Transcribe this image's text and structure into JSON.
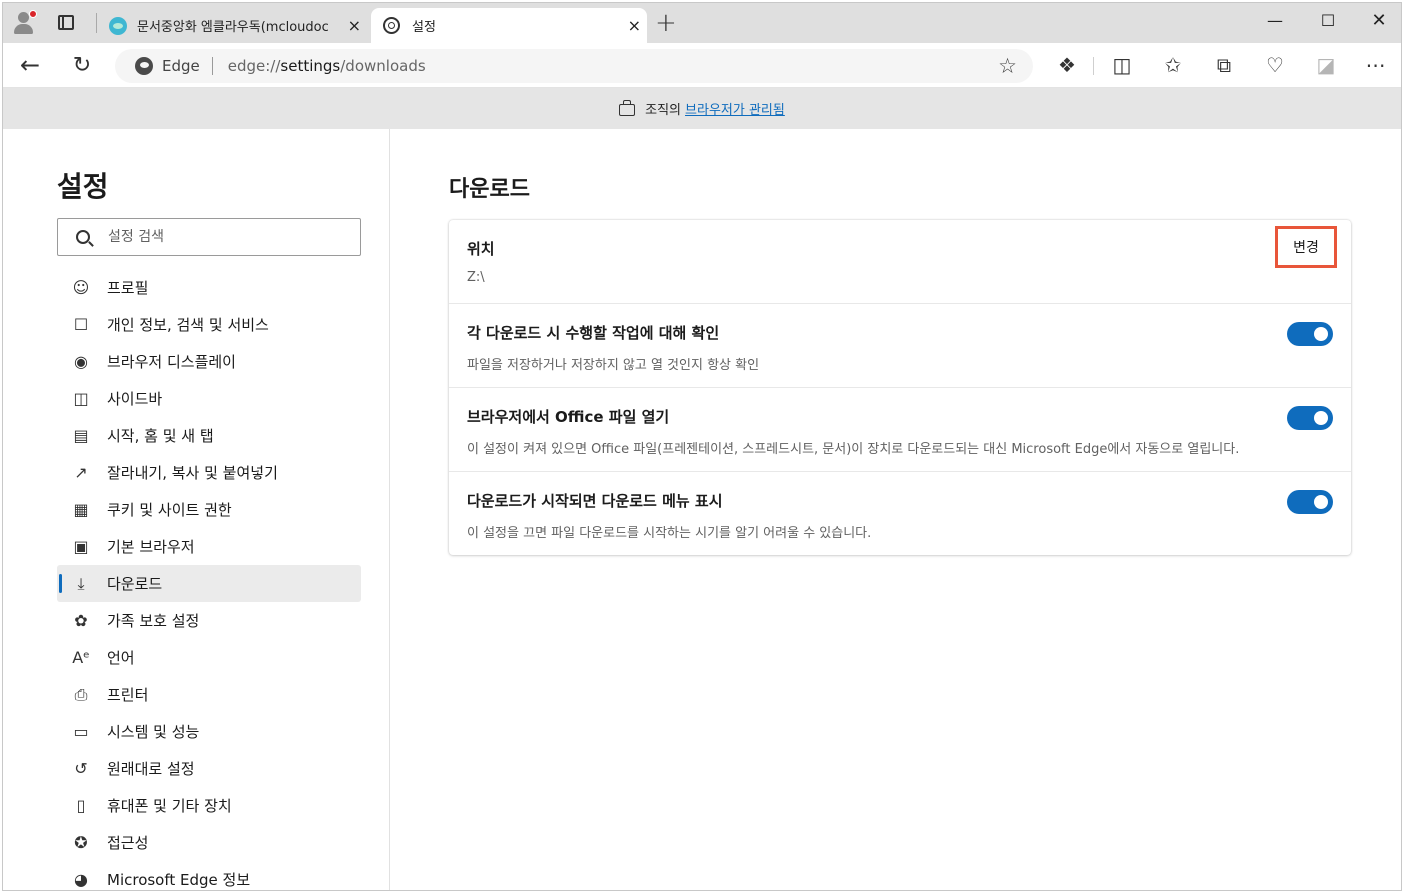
{
  "tabs": [
    {
      "title": "문서중앙화 엠클라우독(mcloudoc",
      "close": "×"
    },
    {
      "title": "설정",
      "close": "×"
    }
  ],
  "window": {
    "minimize": "—",
    "maximize": "☐",
    "close": "✕",
    "new_tab": "+"
  },
  "toolbar": {
    "brand": "Edge",
    "url_prefix": "edge://",
    "url_host": "settings",
    "url_path": "/downloads",
    "icons": [
      "back-icon",
      "refresh-icon",
      "star-icon",
      "extensions-icon",
      "split-screen-icon",
      "favorites-icon",
      "collections-icon",
      "browser-essentials-icon",
      "ie-mode-icon",
      "more-icon"
    ]
  },
  "managed": {
    "prefix": "조직의",
    "link": "브라우저가 관리됨"
  },
  "sidebar": {
    "title": "설정",
    "search_placeholder": "설정 검색",
    "items": [
      {
        "label": "프로필",
        "icon": "profile-icon"
      },
      {
        "label": "개인 정보, 검색 및 서비스",
        "icon": "lock-icon"
      },
      {
        "label": "브라우저 디스플레이",
        "icon": "palette-icon"
      },
      {
        "label": "사이드바",
        "icon": "sidebar-icon"
      },
      {
        "label": "시작, 홈 및 새 탭",
        "icon": "home-tab-icon"
      },
      {
        "label": "잘라내기, 복사 및 붙여넣기",
        "icon": "share-icon"
      },
      {
        "label": "쿠키 및 사이트 권한",
        "icon": "site-permissions-icon"
      },
      {
        "label": "기본 브라우저",
        "icon": "default-browser-icon"
      },
      {
        "label": "다운로드",
        "icon": "download-icon",
        "active": true
      },
      {
        "label": "가족 보호 설정",
        "icon": "family-icon"
      },
      {
        "label": "언어",
        "icon": "language-icon"
      },
      {
        "label": "프린터",
        "icon": "printer-icon"
      },
      {
        "label": "시스템 및 성능",
        "icon": "laptop-icon"
      },
      {
        "label": "원래대로 설정",
        "icon": "reset-icon"
      },
      {
        "label": "휴대폰 및 기타 장치",
        "icon": "phone-icon"
      },
      {
        "label": "접근성",
        "icon": "accessibility-icon"
      },
      {
        "label": "Microsoft Edge 정보",
        "icon": "edge-logo-icon"
      }
    ]
  },
  "main": {
    "title": "다운로드",
    "location": {
      "label": "위치",
      "value": "Z:\\",
      "button": "변경"
    },
    "settings": [
      {
        "title": "각 다운로드 시 수행할 작업에 대해 확인",
        "desc": "파일을 저장하거나 저장하지 않고 열 것인지 항상 확인",
        "enabled": true
      },
      {
        "title": "브라우저에서 Office 파일 열기",
        "desc": "이 설정이 켜져 있으면 Office 파일(프레젠테이션, 스프레드시트, 문서)이 장치로 다운로드되는 대신 Microsoft Edge에서 자동으로 열립니다.",
        "enabled": true
      },
      {
        "title": "다운로드가 시작되면 다운로드 메뉴 표시",
        "desc": "이 설정을 끄면 파일 다운로드를 시작하는 시기를 알기 어려울 수 있습니다.",
        "enabled": true
      }
    ]
  },
  "colors": {
    "accent": "#0f6cbd",
    "highlight_border": "#e8563a"
  }
}
